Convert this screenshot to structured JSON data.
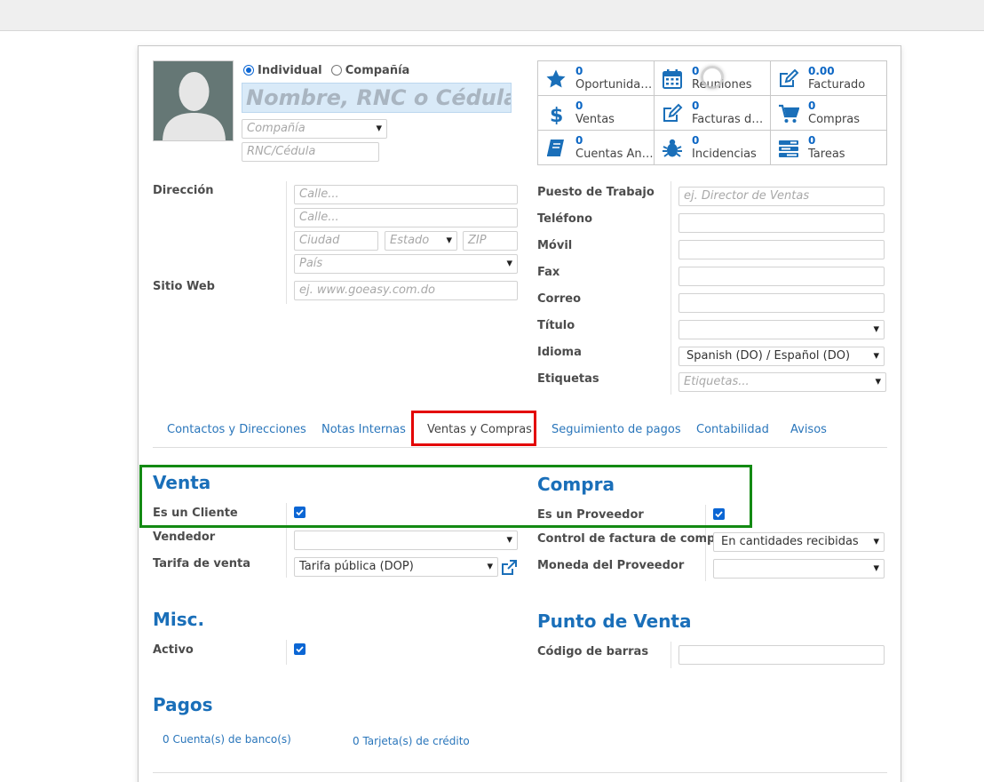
{
  "partner_type": {
    "individual": "Individual",
    "company": "Compañía",
    "selected": "individual"
  },
  "header": {
    "name_placeholder": "Nombre, RNC o Cédula",
    "company_placeholder": "Compañía",
    "rnc_placeholder": "RNC/Cédula"
  },
  "stats": [
    {
      "count": "0",
      "label": "Oportunidades",
      "icon": "star-icon"
    },
    {
      "count": "0",
      "label": "Reuniones",
      "icon": "calendar-icon"
    },
    {
      "count": "0.00",
      "label": "Facturado",
      "icon": "pencil-square-icon"
    },
    {
      "count": "0",
      "label": "Ventas",
      "icon": "dollar-icon"
    },
    {
      "count": "0",
      "label": "Facturas de ...",
      "icon": "pencil-square-icon"
    },
    {
      "count": "0",
      "label": "Compras",
      "icon": "cart-icon"
    },
    {
      "count": "0",
      "label": "Cuentas Anal...",
      "icon": "book-icon"
    },
    {
      "count": "0",
      "label": "Incidencias",
      "icon": "bug-icon"
    },
    {
      "count": "0",
      "label": "Tareas",
      "icon": "tasks-icon"
    }
  ],
  "address": {
    "label": "Dirección",
    "street_placeholder": "Calle...",
    "street2_placeholder": "Calle...",
    "city_placeholder": "Ciudad",
    "state_placeholder": "Estado",
    "zip_placeholder": "ZIP",
    "country_placeholder": "País"
  },
  "website": {
    "label": "Sitio Web",
    "placeholder": "ej. www.goeasy.com.do"
  },
  "right_fields": {
    "job_label": "Puesto de Trabajo",
    "job_placeholder": "ej. Director de Ventas",
    "phone_label": "Teléfono",
    "mobile_label": "Móvil",
    "fax_label": "Fax",
    "email_label": "Correo",
    "title_label": "Título",
    "language_label": "Idioma",
    "language_value": "Spanish (DO) / Español (DO)",
    "tags_label": "Etiquetas",
    "tags_placeholder": "Etiquetas..."
  },
  "tabs": [
    {
      "label": "Contactos y Direcciones"
    },
    {
      "label": "Notas Internas"
    },
    {
      "label": "Ventas y Compras",
      "active": true
    },
    {
      "label": "Seguimiento de pagos"
    },
    {
      "label": "Contabilidad"
    },
    {
      "label": "Avisos"
    }
  ],
  "sales": {
    "title": "Venta",
    "is_customer_label": "Es un Cliente",
    "is_customer": true,
    "salesperson_label": "Vendedor",
    "pricelist_label": "Tarifa de venta",
    "pricelist_value": "Tarifa pública (DOP)"
  },
  "purchase": {
    "title": "Compra",
    "is_vendor_label": "Es un Proveedor",
    "is_vendor": true,
    "bill_control_label": "Control de factura de compra",
    "bill_control_value": "En cantidades recibidas",
    "vendor_currency_label": "Moneda del Proveedor"
  },
  "misc": {
    "title": "Misc.",
    "active_label": "Activo",
    "active": true
  },
  "pos": {
    "title": "Punto de Venta",
    "barcode_label": "Código de barras"
  },
  "payments": {
    "title": "Pagos",
    "bank_accounts": "0 Cuenta(s) de banco(s)",
    "credit_cards": "0 Tarjeta(s) de crédito"
  },
  "colors": {
    "accent": "#1a6fb9",
    "checkbox": "#0b66d4",
    "highlight_red": "#e30000",
    "highlight_green": "#138a13"
  }
}
